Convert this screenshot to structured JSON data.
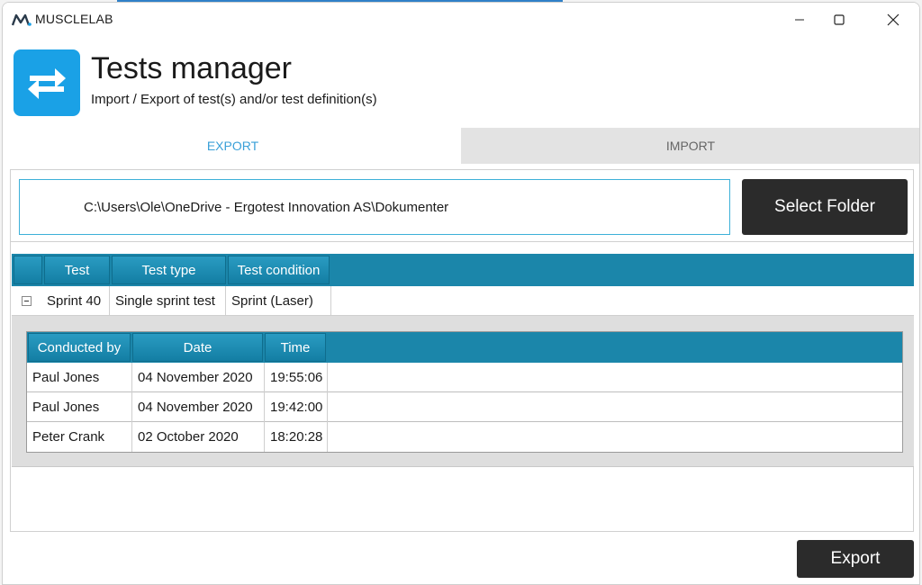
{
  "app": {
    "name": "MUSCLELAB"
  },
  "header": {
    "title": "Tests manager",
    "subtitle": "Import / Export of test(s) and/or test definition(s)",
    "icon": "swap-arrows-icon",
    "icon_color": "#1aa1e6"
  },
  "tabs": [
    {
      "label": "EXPORT",
      "active": true
    },
    {
      "label": "IMPORT",
      "active": false
    }
  ],
  "export": {
    "folder_path": "C:\\Users\\Ole\\OneDrive - Ergotest Innovation AS\\Dokumenter",
    "select_folder_label": "Select Folder",
    "export_label": "Export"
  },
  "tests_grid": {
    "columns": [
      "Test",
      "Test type",
      "Test condition"
    ],
    "rows": [
      {
        "test": "Sprint 40",
        "test_type": "Single sprint test",
        "test_condition": "Sprint (Laser)",
        "expanded": true
      }
    ]
  },
  "details_grid": {
    "columns": [
      "Conducted by",
      "Date",
      "Time"
    ],
    "rows": [
      {
        "conducted_by": "Paul Jones",
        "date": "04 November 2020",
        "time": "19:55:06"
      },
      {
        "conducted_by": "Paul Jones",
        "date": "04 November 2020",
        "time": "19:42:00"
      },
      {
        "conducted_by": "Peter Crank",
        "date": "02 October 2020",
        "time": "18:20:28"
      }
    ]
  },
  "colors": {
    "grid_header": "#1b86aa",
    "active_tab_text": "#3aa0d8",
    "dark_button": "#2b2b2b"
  }
}
